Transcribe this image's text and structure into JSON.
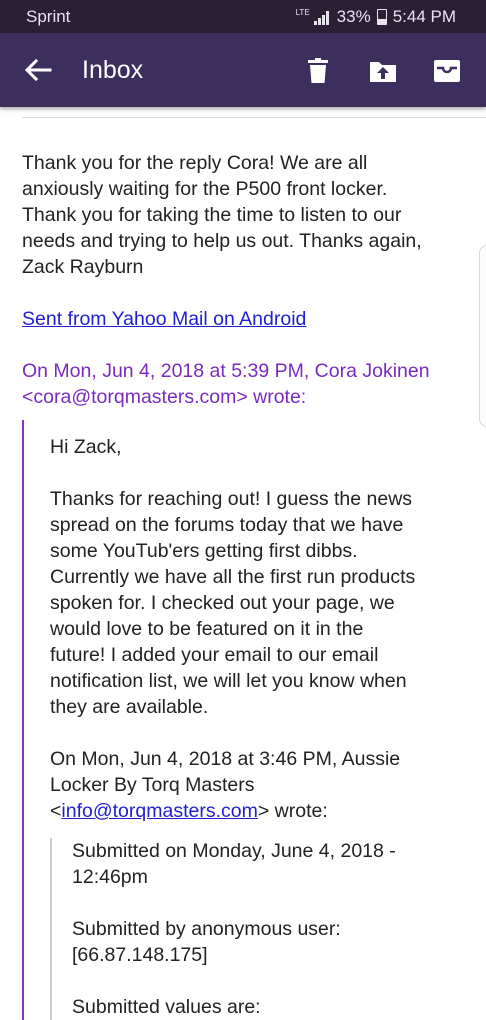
{
  "status_bar": {
    "carrier": "Sprint",
    "network": "LTE",
    "battery": "33%",
    "time": "5:44 PM"
  },
  "app_bar": {
    "title": "Inbox",
    "icons": [
      "back-arrow-icon",
      "trash-icon",
      "move-to-folder-icon",
      "archive-icon"
    ]
  },
  "email": {
    "reply_body": "Thank you for the reply Cora! We are all\nanxiously waiting for the P500 front locker.\nThank you for taking the time to listen to our\nneeds and trying to help us out. Thanks again,\nZack Rayburn",
    "signature_link": "Sent from Yahoo Mail on Android",
    "quote_header": "On Mon, Jun 4, 2018 at 5:39 PM, Cora Jokinen\n<cora@torqmasters.com> wrote:",
    "quoted": {
      "greeting": "Hi Zack,",
      "body": "Thanks for reaching out! I guess the news\nspread on the forums today that we have\nsome YouTub'ers getting first dibbs.\nCurrently we have all the first run products\nspoken for. I checked out your page, we\nwould love to be featured on it in the\nfuture! I added your email to our email\nnotification list, we will let you know when\nthey are available.",
      "inner_header_line1": "On Mon, Jun 4, 2018 at 3:46 PM, Aussie\nLocker By Torq Masters",
      "inner_header_lt": "<",
      "inner_header_email": "info@torqmasters.com",
      "inner_header_end": "> wrote:",
      "inner_quote": {
        "submitted_on": "Submitted on Monday, June 4, 2018 -\n12:46pm",
        "submitted_by": "Submitted by anonymous user:\n[66.87.148.175]",
        "submitted_values": "Submitted values are:"
      }
    }
  },
  "colors": {
    "status_bar_bg": "#2a1f35",
    "app_bar_bg": "#3c2e5d",
    "link_blue": "#1f1fd1",
    "quote_purple": "#7a2bbf",
    "quote_bar": "#8c2fd0"
  }
}
